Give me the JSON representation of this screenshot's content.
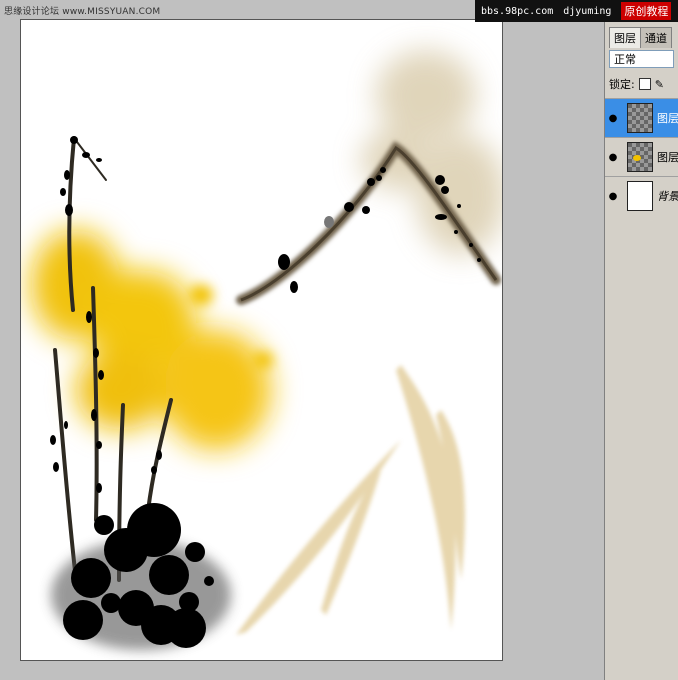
{
  "watermark": {
    "left_text": "思缘设计论坛 www.MISSYUAN.COM",
    "right_site": "bbs.98pc.com",
    "right_author": "djyuming",
    "right_label": "原创教程"
  },
  "layers_panel": {
    "tabs": [
      {
        "label": "图层"
      },
      {
        "label": "通道"
      }
    ],
    "blend_mode": "正常",
    "lock_label": "锁定:",
    "layers": [
      {
        "name": "图层",
        "visible": true,
        "selected": true
      },
      {
        "name": "图层",
        "visible": true,
        "selected": false
      },
      {
        "name": "背景",
        "visible": true,
        "selected": false
      }
    ]
  },
  "colors": {
    "workspace": "#c0c0c0",
    "selection": "#3a8ee6",
    "ink": "#000000",
    "gold": "#f2c200",
    "tan": "#c8b48e"
  }
}
